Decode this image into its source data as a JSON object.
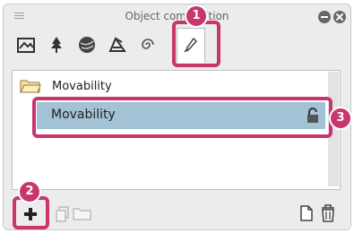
{
  "window": {
    "title": "Object composition"
  },
  "tabs": [
    {
      "icon": "layer-background-icon"
    },
    {
      "icon": "tree-icon"
    },
    {
      "icon": "sphere-icon"
    },
    {
      "icon": "perspective-icon"
    },
    {
      "icon": "spiral-icon"
    },
    {
      "icon": "brush-icon",
      "active": true
    }
  ],
  "list": {
    "folder": {
      "label": "Movability",
      "icon": "folder-icon"
    },
    "items": [
      {
        "label": "Movability",
        "selected": true,
        "icon": "lock-icon"
      }
    ]
  },
  "callouts": [
    "1",
    "2",
    "3"
  ],
  "colors": {
    "highlight": "#c7376e",
    "selected_row": "#a3c2d6"
  },
  "bottom_toolbar": {
    "icons": [
      "add-icon",
      "duplicate-icon",
      "folder-add-icon",
      "new-page-icon",
      "trash-icon"
    ]
  }
}
